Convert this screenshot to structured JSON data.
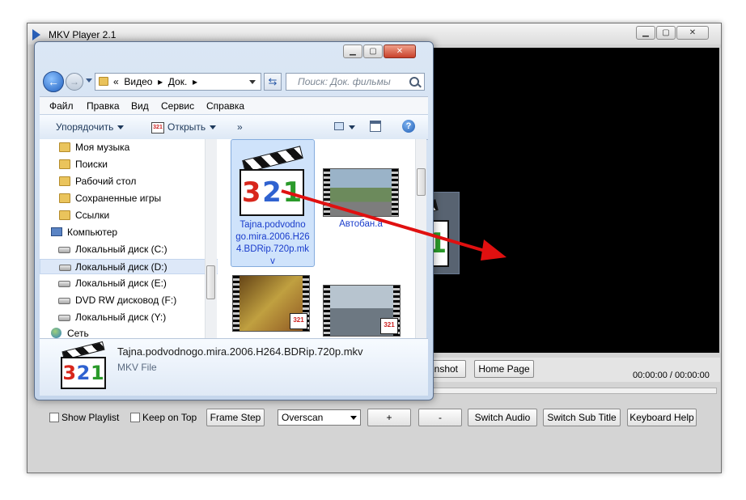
{
  "mkv": {
    "title": "MKV Player 2.1",
    "buttons": {
      "screenshot": "enshot",
      "home_page": "Home Page",
      "frame_step": "Frame Step",
      "plus": "+",
      "minus": "-",
      "switch_audio": "Switch Audio",
      "switch_sub_title": "Switch Sub Title",
      "keyboard_help": "Keyboard Help"
    },
    "time_current": "00:00:00",
    "time_separator": "/",
    "time_total": "00:00:00",
    "show_playlist_label": "Show Playlist",
    "keep_on_top_label": "Keep on Top",
    "aspect_select_value": "Overscan"
  },
  "explorer": {
    "address": {
      "prefix": "«",
      "crumb1": "Видео",
      "sep1": "▸",
      "crumb2": "Док.",
      "sep2": "▸"
    },
    "search_placeholder": "Поиск: Док. фильмы",
    "menu": [
      "Файл",
      "Правка",
      "Вид",
      "Сервис",
      "Справка"
    ],
    "toolbar": {
      "organize": "Упорядочить",
      "open": "Открыть",
      "more": "»",
      "help": "?"
    },
    "nav_items": [
      "Моя музыка",
      "Поиски",
      "Рабочий стол",
      "Сохраненные игры",
      "Ссылки",
      "Компьютер",
      "Локальный диск (C:)",
      "Локальный диск (D:)",
      "Локальный диск (E:)",
      "DVD RW дисковод (F:)",
      "Локальный диск (Y:)",
      "Сеть"
    ],
    "files": [
      {
        "name_line1": "Tajna.podvodno",
        "name_line2": "go.mira.2006.H26",
        "name_line3": "4.BDRip.720p.mk",
        "name_line4": "v"
      },
      {
        "name": "Автобан.а"
      }
    ],
    "details": {
      "filename": "Tajna.podvodnogo.mira.2006.H264.BDRip.720p.mkv",
      "filetype": "MKV File"
    }
  },
  "logo_digits": {
    "d3": "3",
    "d2": "2",
    "d1": "1"
  }
}
